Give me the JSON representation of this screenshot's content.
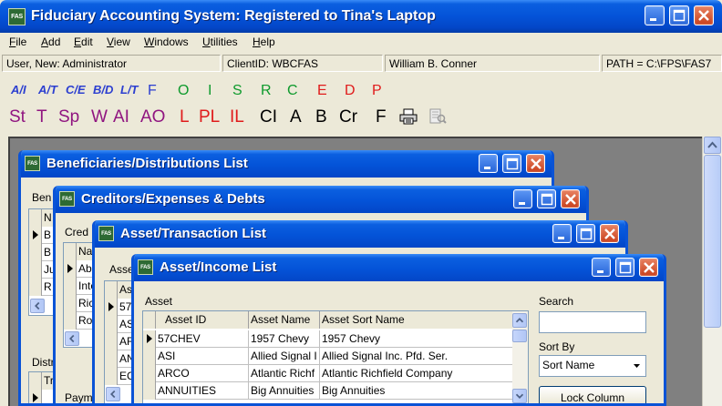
{
  "app": {
    "title": "Fiduciary Accounting System: Registered to Tina's Laptop",
    "icon_label": "FAS"
  },
  "menu": [
    "File",
    "Add",
    "Edit",
    "View",
    "Windows",
    "Utilities",
    "Help"
  ],
  "status": {
    "user": "User, New: Administrator",
    "client": "ClientID: WBCFAS",
    "name": "William B. Conner",
    "path": "PATH = C:\\FPS\\FAS7"
  },
  "toolbar1": {
    "fracs": [
      "A/I",
      "A/T",
      "C/E",
      "B/D",
      "L/T"
    ],
    "letters": [
      {
        "t": "F",
        "c": "blue"
      },
      {
        "t": "O",
        "c": "green"
      },
      {
        "t": "I",
        "c": "green"
      },
      {
        "t": "S",
        "c": "green"
      },
      {
        "t": "R",
        "c": "green"
      },
      {
        "t": "C",
        "c": "green"
      },
      {
        "t": "E",
        "c": "red"
      },
      {
        "t": "D",
        "c": "red"
      },
      {
        "t": "P",
        "c": "red"
      }
    ]
  },
  "toolbar2": {
    "letters": [
      {
        "t": "St",
        "c": "purple"
      },
      {
        "t": "T",
        "c": "purple"
      },
      {
        "t": "Sp",
        "c": "purple"
      },
      {
        "t": "W",
        "c": "purple"
      },
      {
        "t": "AI",
        "c": "purple"
      },
      {
        "t": "AO",
        "c": "purple"
      },
      {
        "t": "L",
        "c": "red"
      },
      {
        "t": "PL",
        "c": "red"
      },
      {
        "t": "IL",
        "c": "red"
      },
      {
        "t": "CI",
        "c": "black"
      },
      {
        "t": "A",
        "c": "black"
      },
      {
        "t": "B",
        "c": "black"
      },
      {
        "t": "Cr",
        "c": "black"
      },
      {
        "t": "F",
        "c": "black"
      }
    ]
  },
  "windows": {
    "beneficiaries": {
      "title": "Beneficiaries/Distributions List",
      "label": "Ben",
      "col": "N",
      "rows": [
        "B",
        "B",
        "Ju",
        "R"
      ],
      "bottom_label": "Distr",
      "bottom_col": "Tr"
    },
    "creditors": {
      "title": "Creditors/Expenses & Debts",
      "label": "Cred",
      "col": "Na",
      "rows": [
        "Ab",
        "Inte",
        "Ric",
        "Ro"
      ],
      "bottom_label": "Paym"
    },
    "asset_transaction": {
      "title": "Asset/Transaction List",
      "label": "Asse",
      "col": "As",
      "rows": [
        "57",
        "AS",
        "AR",
        "AN",
        "EC"
      ]
    },
    "asset_income": {
      "title": "Asset/Income List",
      "group_label": "Asset",
      "columns": [
        "Asset ID",
        "Asset Name",
        "Asset Sort Name"
      ],
      "rows": [
        [
          "57CHEV",
          "1957 Chevy",
          "1957 Chevy"
        ],
        [
          "ASI",
          "Allied Signal I",
          "Allied Signal Inc. Pfd. Ser."
        ],
        [
          "ARCO",
          "Atlantic Richf",
          "Atlantic Richfield Company"
        ],
        [
          "ANNUITIES",
          "Big Annuities",
          "Big Annuities"
        ]
      ],
      "search_label": "Search",
      "search_value": "",
      "sortby_label": "Sort By",
      "sortby_value": "Sort Name",
      "lock_button": "Lock Column"
    }
  }
}
